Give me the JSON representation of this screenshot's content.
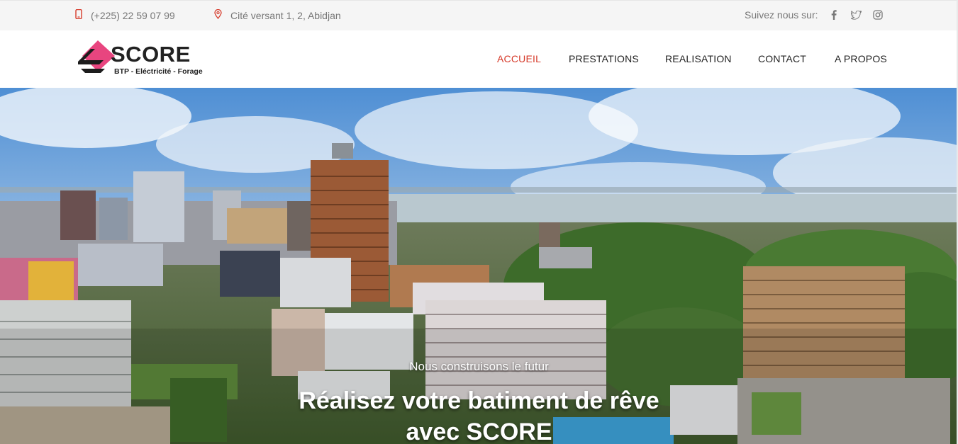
{
  "topbar": {
    "phone": "(+225) 22 59 07 99",
    "address": "Cité versant 1, 2, Abidjan",
    "follow_label": "Suivez nous sur:",
    "icons": {
      "phone": "mobile-phone-icon",
      "address": "map-pin-icon"
    },
    "social": [
      "facebook-icon",
      "twitter-icon",
      "instagram-icon"
    ],
    "accent_color": "#d63a2a"
  },
  "logo": {
    "name": "SCORE",
    "tagline": "BTP - Eléctricité - Forage",
    "colors": {
      "diamond": "#e8457f",
      "text": "#222222"
    }
  },
  "nav": {
    "items": [
      "ACCUEIL",
      "PRESTATIONS",
      "REALISATION",
      "CONTACT",
      "A PROPOS"
    ],
    "active": "ACCUEIL",
    "active_color": "#d63a2a"
  },
  "hero": {
    "subtitle": "Nous construisons le futur",
    "title_line1": "Réalisez votre batiment de rêve",
    "title_line2": "avec SCORE"
  }
}
